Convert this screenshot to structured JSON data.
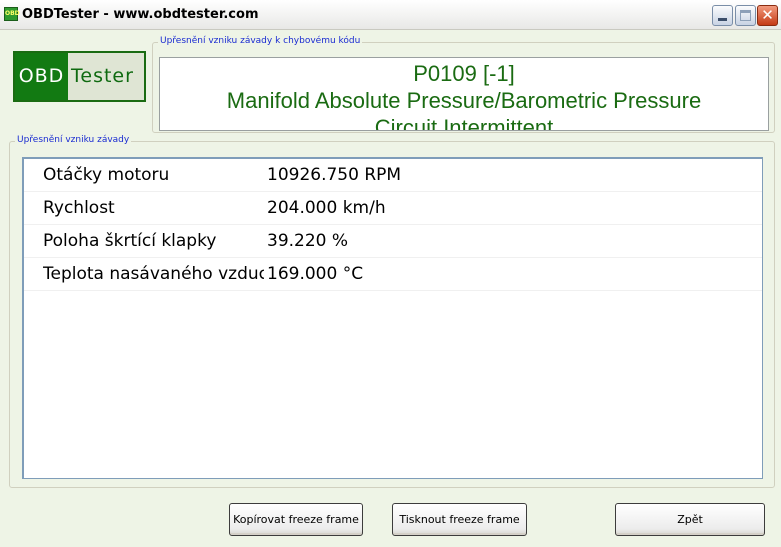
{
  "window": {
    "title": "OBDTester - www.obdtester.com",
    "icon_label": "OBD",
    "controls": {
      "minimize": "minimize-icon",
      "maximize": "maximize-icon",
      "close_glyph": "✕"
    }
  },
  "logo": {
    "part1": "OBD",
    "part2": "Tester"
  },
  "code_group": {
    "legend": "Upřesnění vzniku závady k chybovému kódu",
    "code": "P0109 [-1]",
    "description_line1": "Manifold Absolute Pressure/Barometric Pressure",
    "description_line2": "Circuit Intermittent"
  },
  "freeze_group": {
    "legend": "Upřesnění vzniku závady",
    "rows": [
      {
        "name": "Otáčky motoru",
        "value": "10926.750 RPM"
      },
      {
        "name": "Rychlost",
        "value": "204.000 km/h"
      },
      {
        "name": "Poloha škrtící klapky",
        "value": "39.220 %"
      },
      {
        "name": "Teplota nasávaného vzduchu",
        "value": "169.000 °C"
      }
    ]
  },
  "buttons": {
    "copy": "Kopírovat freeze frame",
    "print": "Tisknout freeze frame",
    "back": "Zpět"
  },
  "colors": {
    "brand_green": "#127a12",
    "legend_blue": "#1a2bd1",
    "background": "#eef4e6"
  }
}
